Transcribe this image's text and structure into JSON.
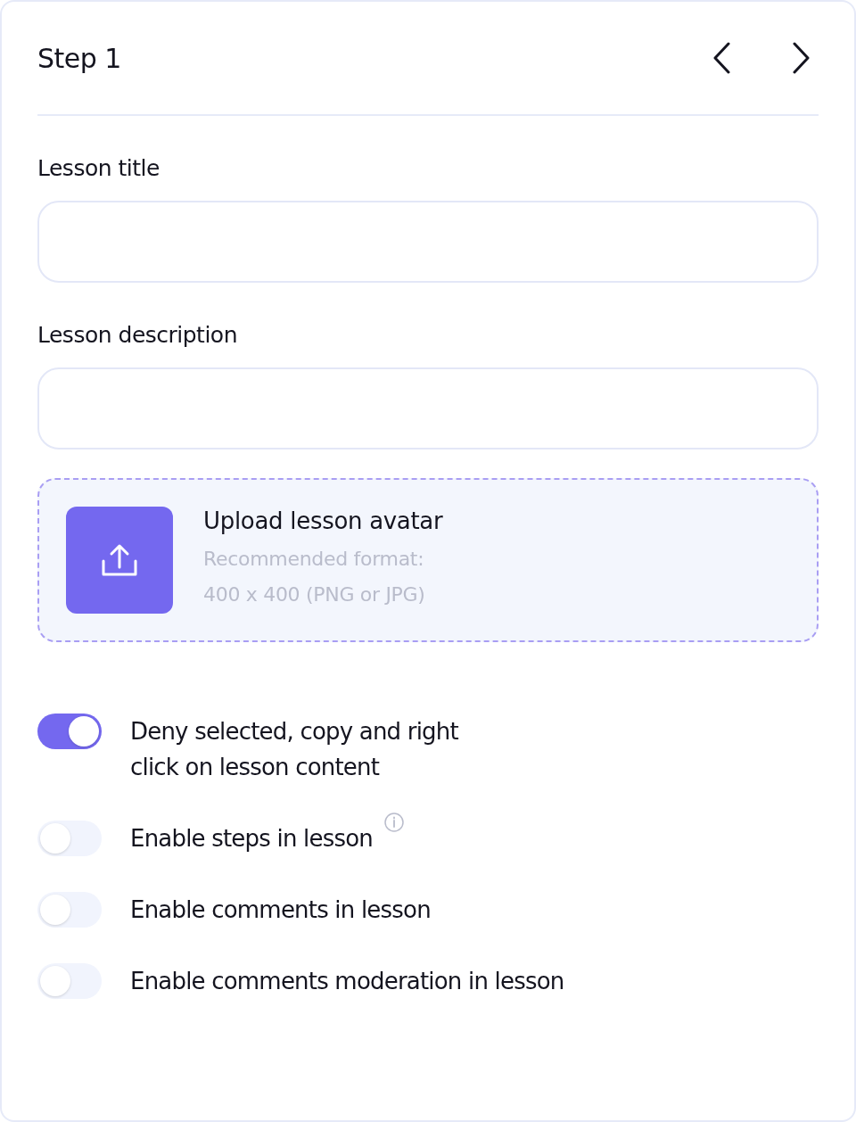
{
  "header": {
    "title": "Step 1"
  },
  "fields": [
    {
      "label": "Lesson title"
    },
    {
      "label": "Lesson description"
    }
  ],
  "upload": {
    "title": "Upload lesson avatar",
    "hint_lines": [
      "Recommended format:",
      "400 x 400 (PNG or JPG)"
    ]
  },
  "toggles": [
    {
      "label_lines": [
        "Deny selected, copy and right",
        "click on lesson content"
      ],
      "on": true,
      "info": false
    },
    {
      "label_lines": [
        "Enable steps in lesson"
      ],
      "on": false,
      "info": true
    },
    {
      "label_lines": [
        "Enable comments in lesson"
      ],
      "on": false,
      "info": false
    },
    {
      "label_lines": [
        "Enable comments moderation in lesson"
      ],
      "on": false,
      "info": false
    }
  ]
}
